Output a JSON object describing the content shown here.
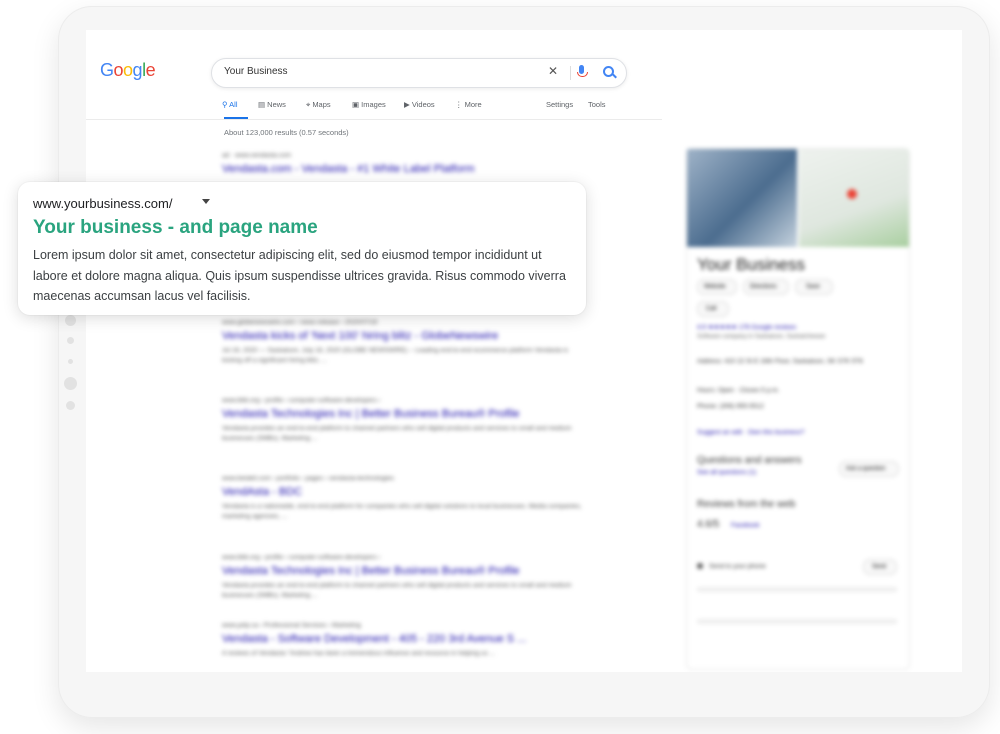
{
  "google": {
    "logo": [
      "G",
      "o",
      "o",
      "g",
      "l",
      "e"
    ],
    "search_query": "Your Business",
    "nav_tabs": [
      "All",
      "News",
      "Maps",
      "Images",
      "Videos",
      "More"
    ],
    "nav_right": [
      "Settings",
      "Tools"
    ],
    "results_stats": "About 123,000 results (0.57 seconds)"
  },
  "results": [
    {
      "url": "ad · www.vendasta.com",
      "title": "Vendasta.com - Vendasta - #1 White Label Platform",
      "desc": ""
    },
    {
      "url": "www.globenewswire.com › news-release › 2020/07/16",
      "title": "Vendasta kicks of 'Next 100' hiring blitz - GlobeNewswire",
      "desc": "Jul 16, 2020 — Saskatoon, July 16, 2020 (GLOBE NEWSWIRE) -- Leading end-to-end ecommerce platform Vendasta is kicking off a significant hiring blitz, ..."
    },
    {
      "url": "www.bbb.org › profile › computer-software-developers ›",
      "title": "Vendasta Technologies Inc | Better Business Bureau® Profile",
      "desc": "Vendasta provides an end-to-end platform to channel partners who sell digital products and services to small and medium businesses (SMBs). Marketing ..."
    },
    {
      "url": "www.betakit.com › portfolio › pages › vendasta-technologies",
      "title": "VendAsta - BDC",
      "desc": "Vendasta is a nationwide, end-to-end platform for companies who sell digital solutions to local businesses. Media companies, marketing agencies, ..."
    },
    {
      "url": "www.bbb.org › profile › computer-software-developers ›",
      "title": "Vendasta Technologies Inc | Better Business Bureau® Profile",
      "desc": "Vendasta provides an end-to-end platform to channel partners who sell digital products and services to small and medium businesses (SMBs). Marketing ..."
    },
    {
      "url": "www.yelp.ca › Professional Services › Marketing",
      "title": "Vendasta - Software Development - 405 - 220 3rd Avenue S ...",
      "desc": "4 reviews of Vendasta \"Andrew has been a tremendous influence and resource in helping us ..."
    }
  ],
  "knowledge_panel": {
    "name": "Your Business",
    "chips": [
      "Website",
      "Directions",
      "Save",
      "Call"
    ],
    "rating": "4.9 ★★★★★ 176 Google reviews",
    "category": "Software company in Saskatoon, Saskatchewan",
    "address": "Address: 410 22 St E 16th Floor, Saskatoon, SK S7K 5T6",
    "hours": "Hours: Open · Closes 5 p.m.",
    "phone": "Phone: (306) 955-5512",
    "suggest": "Suggest an edit · Own this business?",
    "qa_title": "Questions and answers",
    "qa_link": "See all questions (1)",
    "qa_button": "Ask a question",
    "reviews_title": "Reviews from the web",
    "review_score": "4.6/5",
    "review_source": "Facebook",
    "send_label": "Send to your phone",
    "send_button": "Send"
  },
  "card": {
    "url": "www.yourbusiness.com/",
    "title": "Your business - and page name",
    "desc": "Lorem ipsum dolor sit amet, consectetur adipiscing elit, sed do eiusmod tempor incididunt ut labore et dolore magna aliqua. Quis ipsum suspendisse ultrices gravida. Risus commodo viverra maecenas accumsan lacus vel facilisis."
  },
  "colors": {
    "link_blue": "#1a0dab",
    "card_title_green": "#2aa47f",
    "tab_blue": "#1a73e8"
  }
}
